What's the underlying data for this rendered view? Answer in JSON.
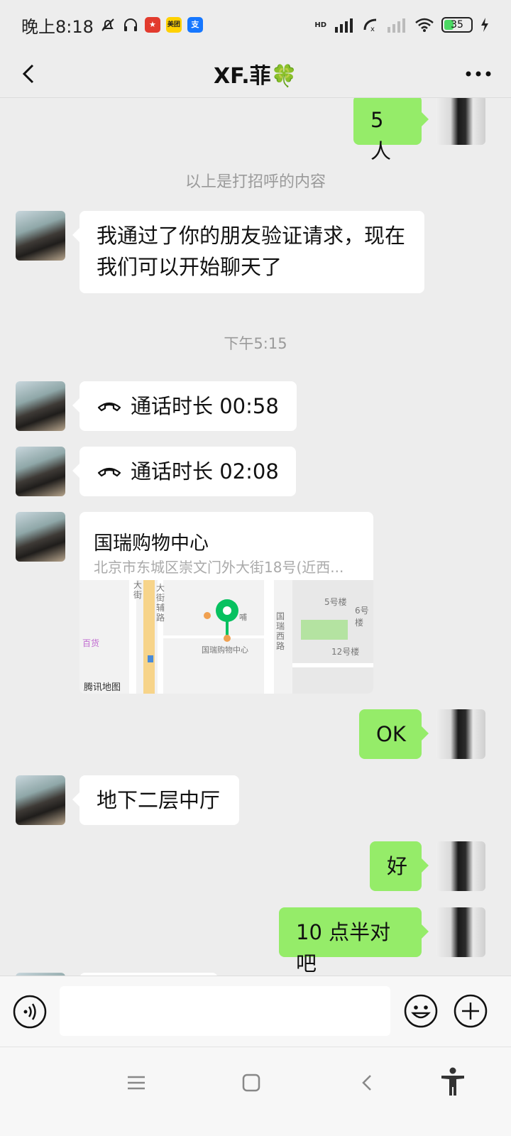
{
  "status_bar": {
    "time": "晚上8:18",
    "battery": "35",
    "app_icons": [
      "meituan",
      "alipay"
    ],
    "meituan_label": "美团",
    "alipay_label": "支",
    "hd_label": "HD"
  },
  "nav": {
    "title": "XF.菲🍀",
    "back_icon": "chevron-left-icon",
    "more_icon": "ellipsis-icon"
  },
  "messages": [
    {
      "side": "out",
      "text": "5 人"
    },
    {
      "type": "system",
      "text": "以上是打招呼的内容"
    },
    {
      "side": "in",
      "text": "我通过了你的朋友验证请求，现在我们可以开始聊天了"
    },
    {
      "type": "time",
      "text": "下午5:15"
    },
    {
      "side": "in",
      "type": "call",
      "text": "通话时长 00:58"
    },
    {
      "side": "in",
      "type": "call",
      "text": "通话时长 02:08"
    },
    {
      "side": "in",
      "type": "location",
      "name": "国瑞购物中心",
      "address": "北京市东城区崇文门外大街18号(近西..."
    },
    {
      "side": "out",
      "text": "OK"
    },
    {
      "side": "in",
      "text": "地下二层中厅"
    },
    {
      "side": "out",
      "text": "好"
    },
    {
      "side": "out",
      "text": "10 点半对吧"
    }
  ],
  "map": {
    "watermark": "腾讯地图",
    "labels": [
      "国瑞购物中心",
      "国瑞西路",
      "5号楼",
      "6号楼",
      "12号楼",
      "百货",
      "大街辅路",
      "大街",
      "哺"
    ]
  },
  "input_bar": {
    "placeholder": "",
    "icons": [
      "voice-icon",
      "emoji-icon",
      "plus-icon"
    ]
  },
  "colors": {
    "out_bubble": "#95ec69",
    "in_bubble": "#ffffff",
    "background": "#ededed",
    "map_pin": "#07c160"
  }
}
